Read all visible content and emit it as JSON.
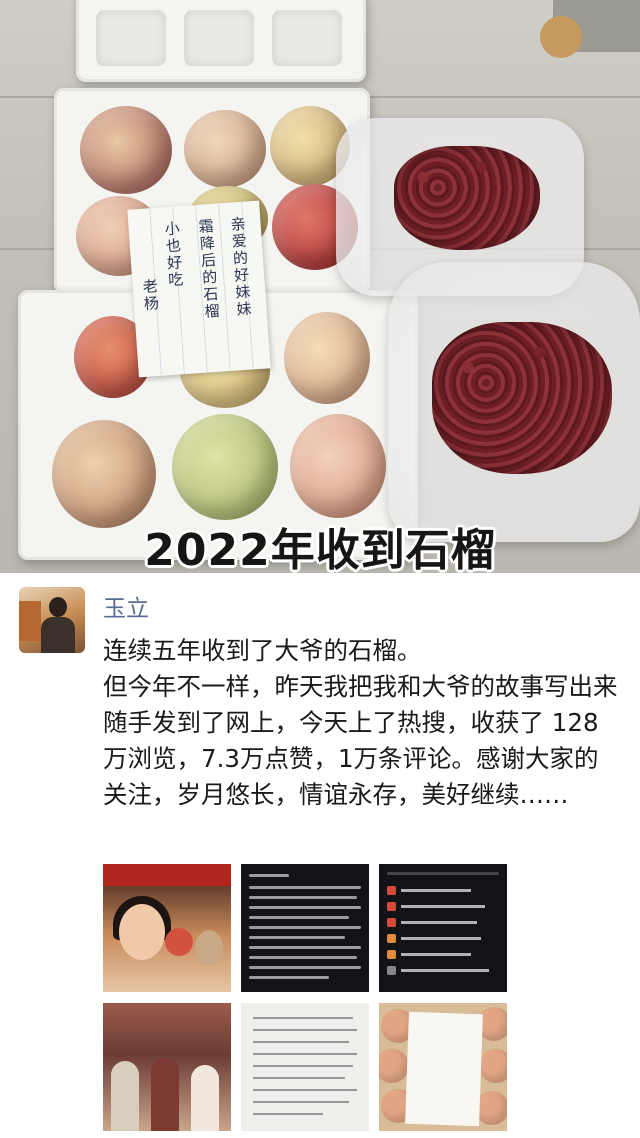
{
  "photo": {
    "caption": "2022年收到石榴",
    "note_lines": [
      "亲爱的好妹妹",
      "霜降后的石榴",
      "小也好吃",
      "老杨"
    ]
  },
  "post": {
    "author": "玉立",
    "text": "连续五年收到了大爷的石榴。\n但今年不一样，昨天我把我和大爷的故事写出来随手发到了网上，今天上了热搜，收获了 128万浏览，7.3万点赞，1万条评论。感谢大家的关注，岁月悠长，情谊永存，美好继续……"
  },
  "thumbnails": [
    {
      "name": "thumb-pomegranate-woman"
    },
    {
      "name": "thumb-post-screenshot"
    },
    {
      "name": "thumb-hot-search-list"
    },
    {
      "name": "thumb-family-photo"
    },
    {
      "name": "thumb-handwritten-letter"
    },
    {
      "name": "thumb-pomegranates-note"
    }
  ],
  "colors": {
    "author_link": "#576b95",
    "body_text": "#1a1a1a",
    "background": "#ffffff"
  },
  "icons": [
    "avatar"
  ]
}
